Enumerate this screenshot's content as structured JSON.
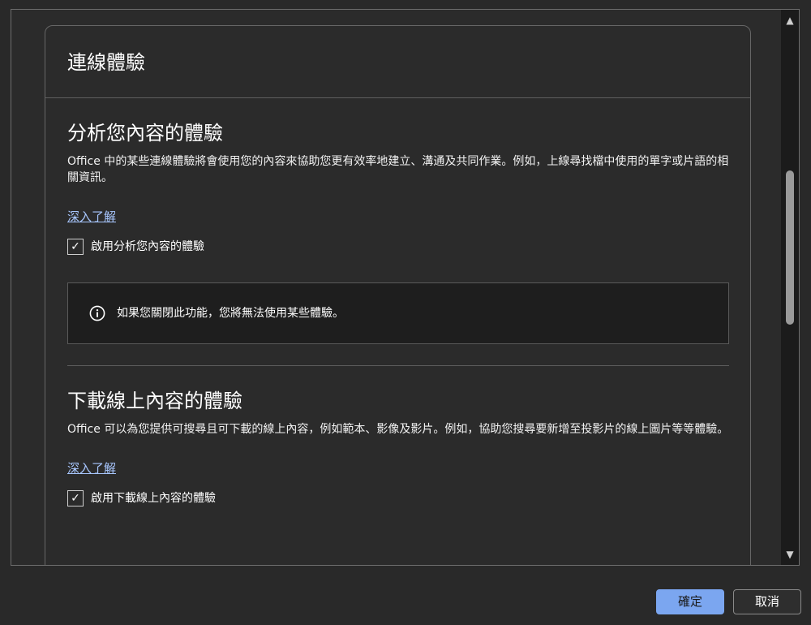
{
  "card": {
    "title": "連線體驗"
  },
  "sections": {
    "analysis": {
      "title": "分析您內容的體驗",
      "description": "Office 中的某些連線體驗將會使用您的內容來協助您更有效率地建立、溝通及共同作業。例如，上線尋找檔中使用的單字或片語的相關資訊。",
      "learn_more": "深入了解",
      "checkbox_label": "啟用分析您內容的體驗",
      "checked": true,
      "info_text": "如果您關閉此功能，您將無法使用某些體驗。"
    },
    "download": {
      "title": "下載線上內容的體驗",
      "description": "Office 可以為您提供可搜尋且可下載的線上內容，例如範本、影像及影片。例如，協助您搜尋要新增至投影片的線上圖片等等體驗。",
      "learn_more": "深入了解",
      "checkbox_label": "啟用下載線上內容的體驗",
      "checked": true
    }
  },
  "icons": {
    "check_glyph": "✓",
    "scroll_up_glyph": "▲",
    "scroll_down_glyph": "▼"
  },
  "buttons": {
    "ok_label": "確定",
    "cancel_label": "取消"
  },
  "colors": {
    "background": "#292929",
    "info_box_background": "#1e1e1e",
    "link": "#a8c7ff",
    "primary_button": "#7ba6f0"
  }
}
